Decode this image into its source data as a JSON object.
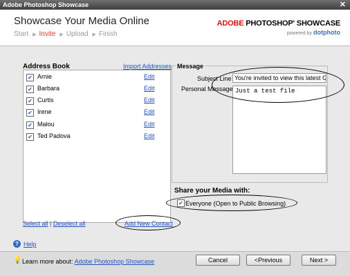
{
  "window": {
    "title": "Adobe Photoshop Showcase",
    "close_glyph": "✕"
  },
  "header": {
    "app_title": "Showcase Your Media Online",
    "steps": [
      "Start",
      "Invite",
      "Upload",
      "Finish"
    ],
    "active_step": "Invite",
    "brand_adobe": "ADOBE",
    "brand_product": " PHOTOSHOP' SHOWCASE",
    "brand_powered": "powered by",
    "brand_partner": "dotphoto"
  },
  "address_book": {
    "title": "Address Book",
    "import_label": "Import Addresses",
    "edit_label": "Edit",
    "contacts": [
      "Arnie",
      "Barbara",
      "Curtis",
      "Irene",
      "Malou",
      "Ted Padova"
    ],
    "select_all": "Select all",
    "separator": "|",
    "deselect_all": "Deselect all",
    "add_contact": "Add New Contact"
  },
  "message": {
    "legend": "Message",
    "subject_label": "Subject Line",
    "subject_value": "You're invited to view this latest G",
    "personal_label": "Personal Message",
    "personal_value": "Just a test file"
  },
  "share": {
    "title": "Share your Media with:",
    "option": "Everyone (Open to Public Browsing)",
    "checked": true
  },
  "footer": {
    "help_label": "Help",
    "learn_prefix": "Learn more about:",
    "learn_link": "Adobe Photoshop Showcase",
    "cancel": "Cancel",
    "previous": "<Previous",
    "next": "Next >"
  }
}
